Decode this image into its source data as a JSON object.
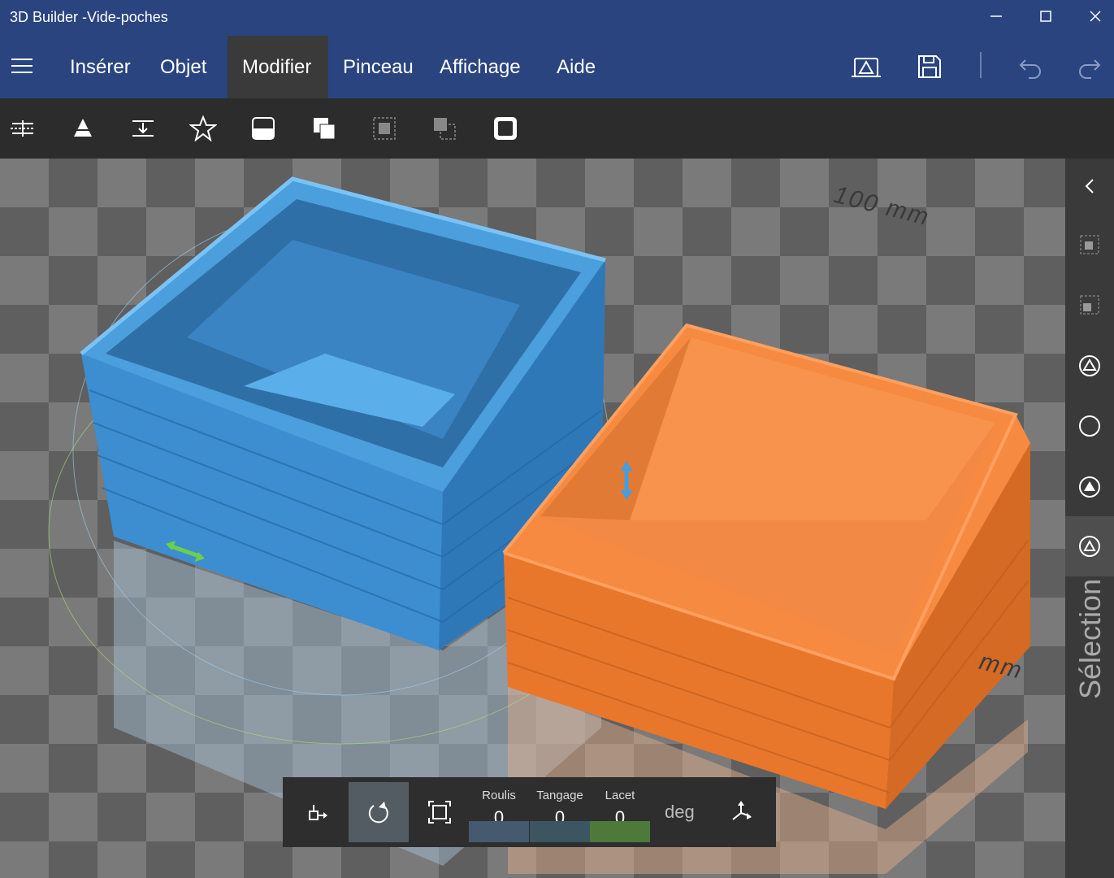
{
  "window": {
    "title": "3D Builder -Vide-poches",
    "controls": [
      "minimize-icon",
      "maximize-icon",
      "close-icon"
    ]
  },
  "menu": {
    "items": [
      {
        "label": "Insérer",
        "active": false
      },
      {
        "label": "Objet",
        "active": false
      },
      {
        "label": "Modifier",
        "active": true
      },
      {
        "label": "Pinceau",
        "active": false
      },
      {
        "label": "Affichage",
        "active": false
      },
      {
        "label": "Aide",
        "active": false
      }
    ],
    "right_icons": [
      "print-3d-icon",
      "save-icon",
      "undo-icon",
      "redo-icon"
    ]
  },
  "toolbar": {
    "icons": [
      "split-icon",
      "cone-icon",
      "extrude-down-icon",
      "emboss-star-icon",
      "simplify-icon",
      "merge-icon",
      "intersect-icon",
      "subtract-icon",
      "hollow-icon"
    ]
  },
  "viewport": {
    "ruler_labels": [
      "100 mm",
      "mm"
    ],
    "colors": {
      "blue_object": "#3f9fe6",
      "orange_object": "#f58a40"
    }
  },
  "side_panel": {
    "label": "Sélection",
    "icons": [
      "collapse-chevron-icon",
      "group-objects-icon",
      "ungroup-objects-icon",
      "select-objects-icon",
      "select-circle-icon",
      "select-faces-icon",
      "selection-mode-icon"
    ]
  },
  "bottom_bar": {
    "fields": [
      {
        "label": "Roulis",
        "value": "0",
        "color": "#455a6e"
      },
      {
        "label": "Tangage",
        "value": "0",
        "color": "#3c5560"
      },
      {
        "label": "Lacet",
        "value": "0",
        "color": "#4d7a3a"
      }
    ],
    "unit": "deg",
    "icons": [
      "move-icon",
      "rotate-icon",
      "scale-icon",
      "reset-transform-icon"
    ]
  }
}
